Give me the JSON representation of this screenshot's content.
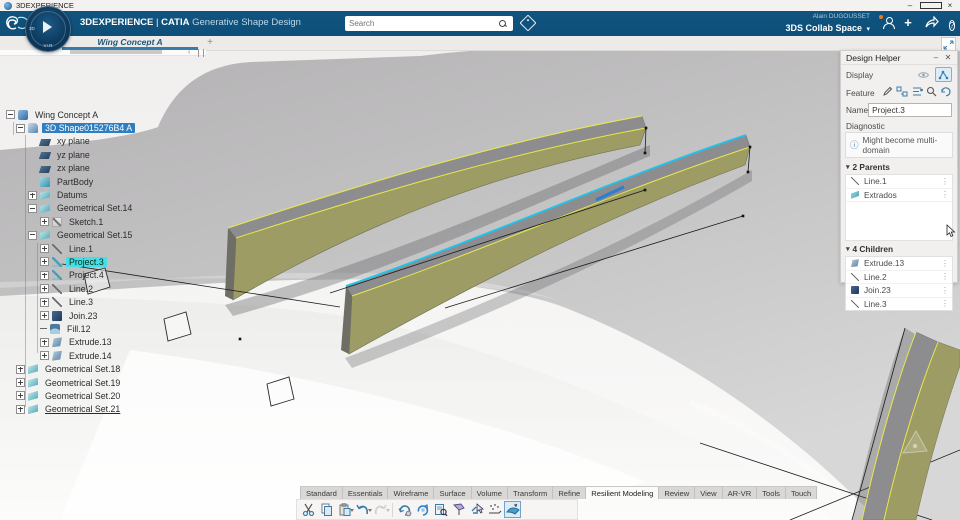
{
  "window": {
    "title": "3DEXPERIENCE",
    "minimize_glyph": "–",
    "close_glyph": "×"
  },
  "appbar": {
    "brand": "3DEXPERIENCE",
    "separator": "|",
    "app": "CATIA",
    "module": "Generative Shape Design",
    "search_placeholder": "Search",
    "user_name": "Alain DUGOUSSET",
    "space": "3DS Collab Space",
    "space_caret": "▾",
    "add_label": "+",
    "help_label": "?",
    "compass_vr": "V+R",
    "compass_3d": "3D"
  },
  "tabs": {
    "active": "Wing Concept A",
    "add": "+",
    "collapse_chevron": "‹"
  },
  "tree": {
    "items": [
      {
        "label": "Wing Concept A"
      },
      {
        "label": "3D Shape015276B4 A"
      },
      {
        "label": "xy plane"
      },
      {
        "label": "yz plane"
      },
      {
        "label": "zx plane"
      },
      {
        "label": "PartBody"
      },
      {
        "label": "Datums"
      },
      {
        "label": "Geometrical Set.14"
      },
      {
        "label": "Sketch.1"
      },
      {
        "label": "Geometrical Set.15"
      },
      {
        "label": "Line.1"
      },
      {
        "label": "Project.3"
      },
      {
        "label": "Project.4"
      },
      {
        "label": "Line.2"
      },
      {
        "label": "Line.3"
      },
      {
        "label": "Join.23"
      },
      {
        "label": "Fill.12"
      },
      {
        "label": "Extrude.13"
      },
      {
        "label": "Extrude.14"
      },
      {
        "label": "Geometrical Set.18"
      },
      {
        "label": "Geometrical Set.19"
      },
      {
        "label": "Geometrical Set.20"
      },
      {
        "label": "Geometrical Set.21"
      }
    ]
  },
  "design_helper": {
    "title": "Design Helper",
    "minimize_glyph": "‒",
    "close_glyph": "✕",
    "display_label": "Display",
    "feature_label": "Feature",
    "name_label": "Name",
    "name_value": "Project.3",
    "diagnostic_label": "Diagnostic",
    "info_glyph": "ⓘ",
    "diagnostic_message": "Might become multi-domain",
    "caret_glyph": "▾",
    "kebab_glyph": "⋮",
    "parents_header": "2 Parents",
    "parents": [
      {
        "label": "Line.1"
      },
      {
        "label": "Extrados"
      }
    ],
    "children_header": "4 Children",
    "children": [
      {
        "label": "Extrude.13"
      },
      {
        "label": "Line.2"
      },
      {
        "label": "Join.23"
      },
      {
        "label": "Line.3"
      }
    ]
  },
  "ribbon": {
    "tabs": [
      {
        "label": "Standard"
      },
      {
        "label": "Essentials"
      },
      {
        "label": "Wireframe"
      },
      {
        "label": "Surface"
      },
      {
        "label": "Volume"
      },
      {
        "label": "Transform"
      },
      {
        "label": "Refine"
      },
      {
        "label": "Resilient Modeling"
      },
      {
        "label": "Review"
      },
      {
        "label": "View"
      },
      {
        "label": "AR-VR"
      },
      {
        "label": "Tools"
      },
      {
        "label": "Touch"
      }
    ],
    "active_tab": "Resilient Modeling"
  },
  "colors": {
    "appbar_blue": "#0f547f",
    "selection_blue": "#2f7fc0",
    "selection_cyan": "#45dde8",
    "spar_khaki": "#9c9c64",
    "flange_gray": "#8d8c8e",
    "edge_yellow": "#e9e94d",
    "highlight_cyan": "#1fc4ee"
  }
}
